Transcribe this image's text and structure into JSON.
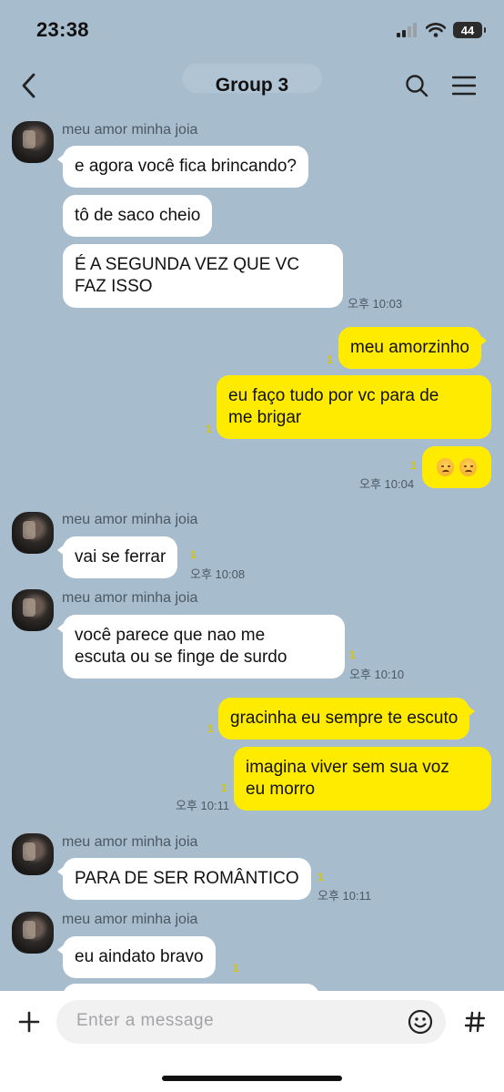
{
  "status_bar": {
    "time": "23:38",
    "battery": "44"
  },
  "header": {
    "title": "Group 3"
  },
  "sender_name": "meu amor minha joia",
  "read_mark": "1",
  "messages": {
    "m1": "e agora você fica brincando?",
    "m2": "tô de saco cheio",
    "m3_line1": "É A SEGUNDA VEZ QUE VC",
    "m3_line2": "FAZ ISSO",
    "t1": "오후 10:03",
    "m4": "meu amorzinho",
    "m5_line1": "eu faço tudo por vc para de",
    "m5_line2": "me brigar",
    "t2": "오후 10:04",
    "m6": "vai se ferrar",
    "t3": "오후 10:08",
    "m7_line1": "você parece que nao me",
    "m7_line2": "escuta ou se finge de surdo",
    "t4": "오후 10:10",
    "m8": "gracinha eu sempre te escuto",
    "m9_line1": "imagina viver sem sua voz",
    "m9_line2": "eu morro",
    "t5": "오후 10:11",
    "m10": "PARA DE SER ROMÂNTICO",
    "t6": "오후 10:11",
    "m11": "eu aindato bravo"
  },
  "input": {
    "placeholder": "Enter a message"
  },
  "colors": {
    "background": "#a7bccd",
    "outgoing_bubble": "#ffeb00",
    "incoming_bubble": "#ffffff",
    "read_mark": "#d8c400"
  },
  "icons": [
    "back-arrow-icon",
    "search-icon",
    "menu-icon",
    "plus-icon",
    "emoji-icon",
    "hash-icon",
    "signal-icon",
    "wifi-icon",
    "battery-icon",
    "pensive-face-emoji"
  ]
}
